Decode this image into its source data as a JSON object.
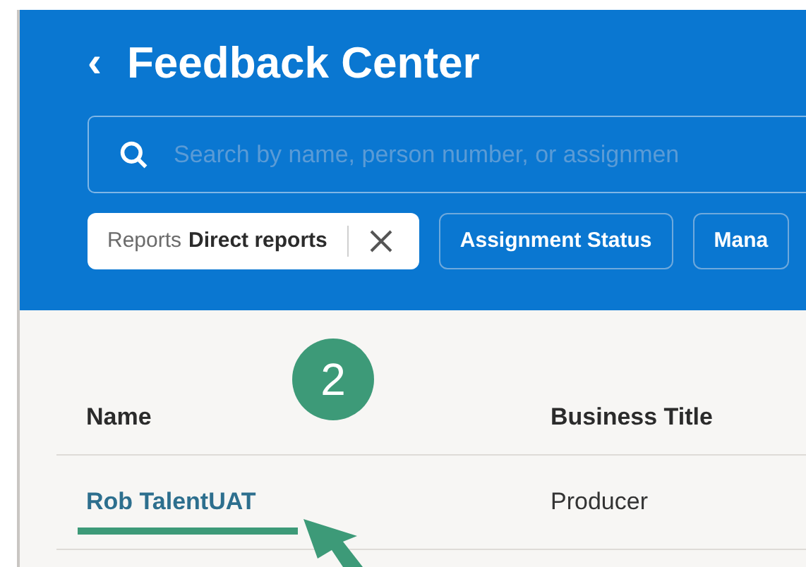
{
  "header": {
    "title": "Feedback Center",
    "back": "‹"
  },
  "search": {
    "placeholder": "Search by name, person number, or assignmen"
  },
  "filters": [
    {
      "kind": "applied",
      "label": "Reports",
      "value": "Direct reports"
    },
    {
      "kind": "plain",
      "label": "Assignment Status"
    },
    {
      "kind": "plain",
      "label": "Mana"
    }
  ],
  "table": {
    "columns": [
      "Name",
      "Business Title"
    ],
    "rows": [
      {
        "name": "Rob TalentUAT",
        "business_title": "Producer"
      }
    ]
  },
  "annotation": {
    "step": "2"
  }
}
